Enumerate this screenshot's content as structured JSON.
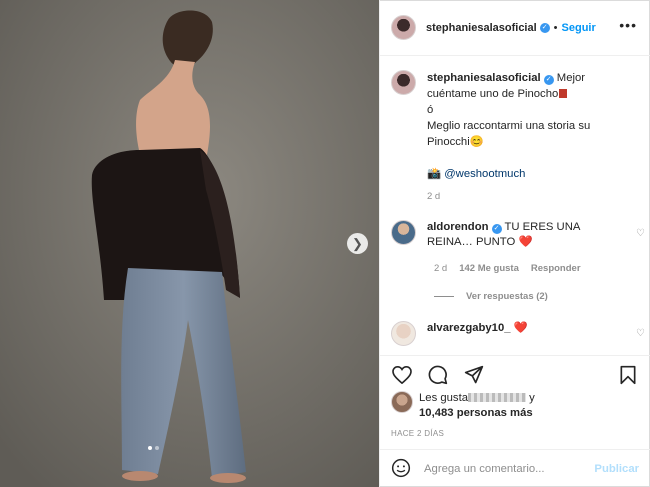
{
  "post": {
    "username": "stephaniesalasoficial",
    "follow_label": "Seguir",
    "separator": "•",
    "more_icon": "more-options-icon",
    "next_icon": "chevron-right-icon"
  },
  "caption": {
    "username": "stephaniesalasoficial",
    "line1": "Mejor",
    "line2": "cuéntame uno de Pinocho",
    "line3": "ó",
    "line4": "Meglio raccontarmi una storia su",
    "line5": "Pinocchi",
    "credit_emoji": "📸",
    "mention": "@weshootmuch",
    "time": "2 d"
  },
  "comments": [
    {
      "username": "aldorendon",
      "text": "TU ERES UNA REINA… PUNTO",
      "heart_emoji": "❤️",
      "time": "2 d",
      "likes": "142 Me gusta",
      "reply": "Responder",
      "view_replies": "Ver respuestas (2)"
    },
    {
      "username": "alvarezgaby10_",
      "heart_emoji": "❤️"
    }
  ],
  "likes": {
    "prefix": "Les gusta",
    "suffix": "y",
    "count": "10,483 personas más"
  },
  "time_ago": "HACE 2 DÍAS",
  "add_comment": {
    "placeholder": "Agrega un comentario...",
    "post_label": "Publicar"
  },
  "colors": {
    "accent": "#0095f6",
    "verified": "#3897f0",
    "photo_bg": "#7a776f"
  }
}
